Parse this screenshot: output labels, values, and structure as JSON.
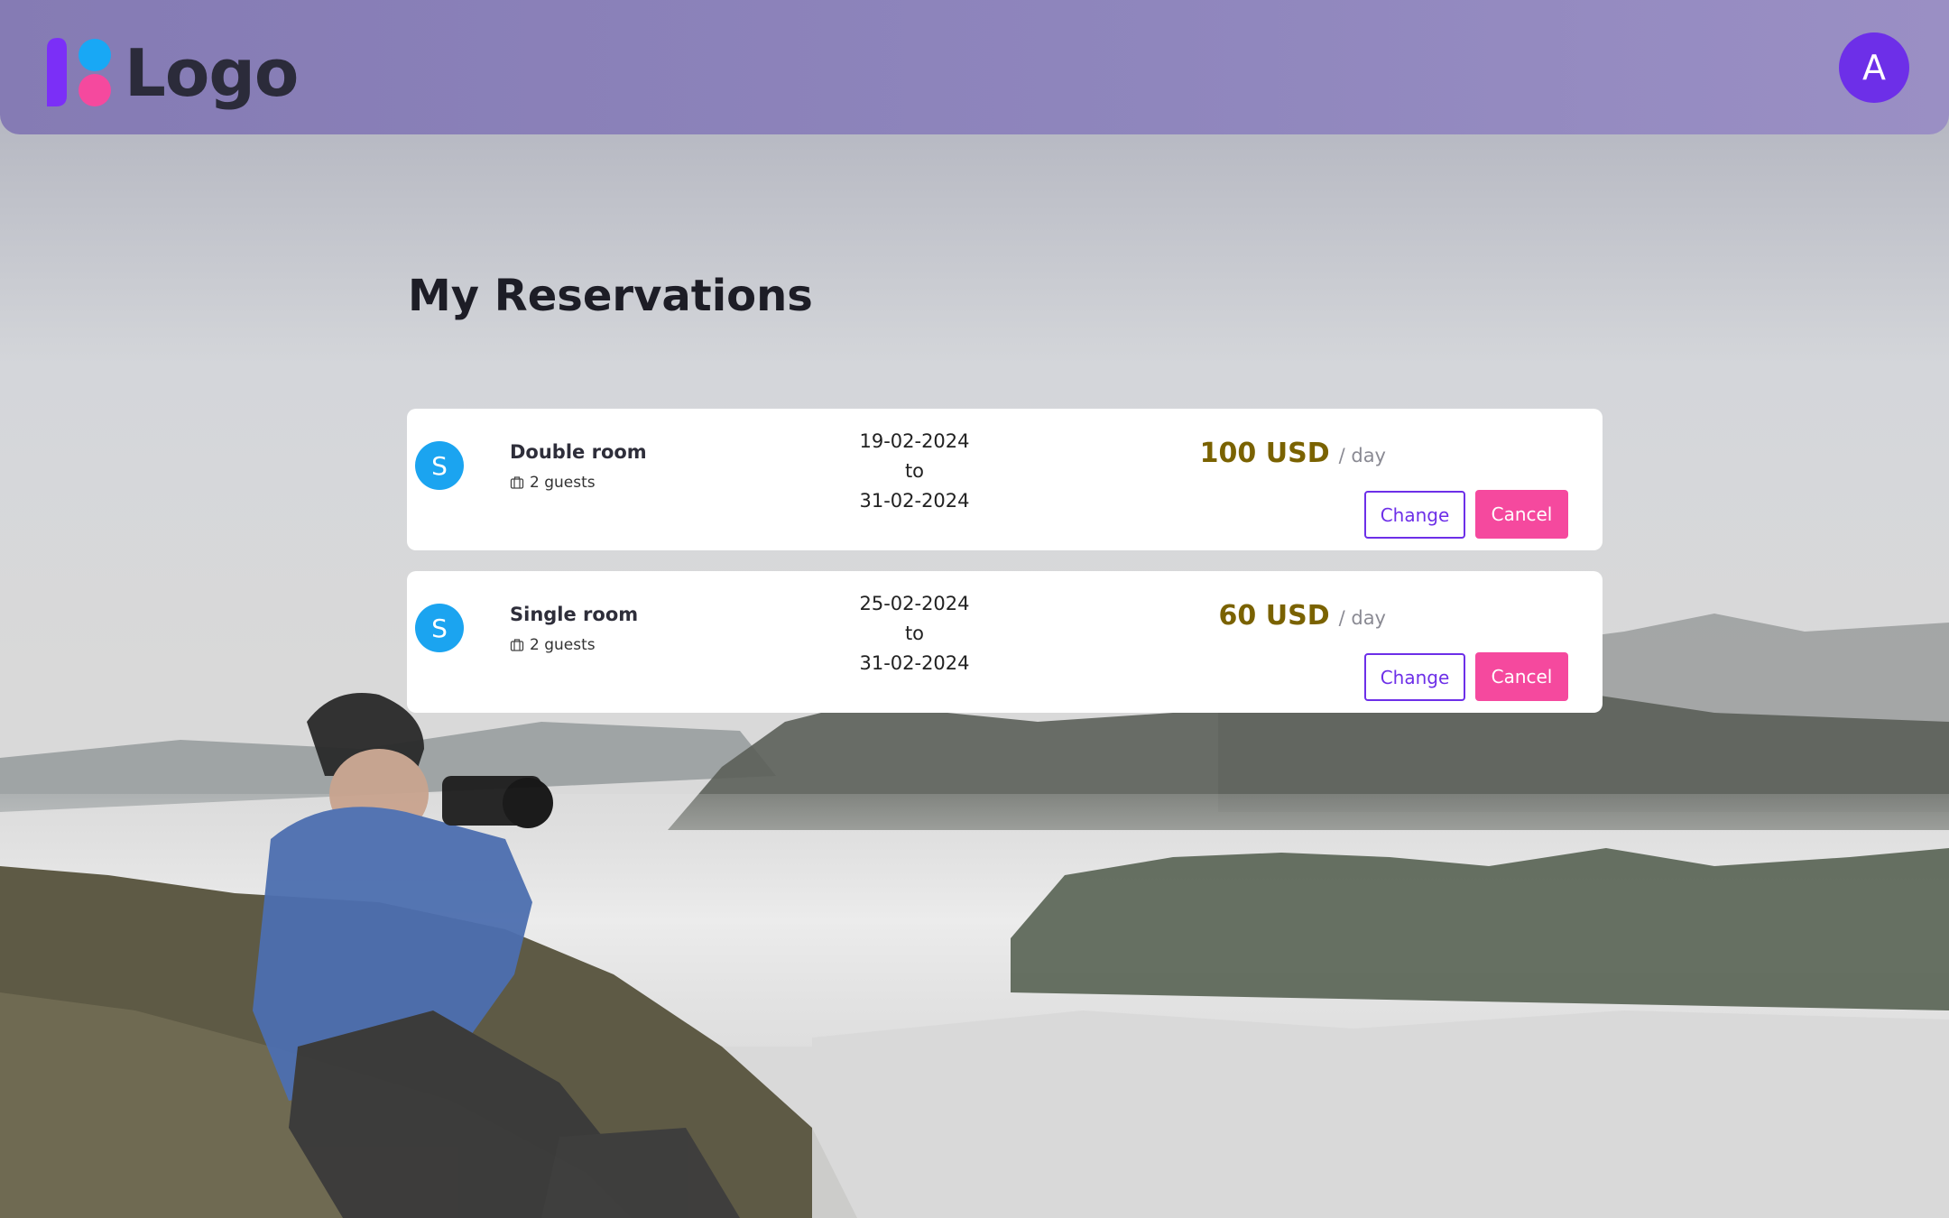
{
  "header": {
    "logo_text": "Logo",
    "avatar_initial": "A"
  },
  "main": {
    "title": "My Reservations",
    "reservations": [
      {
        "badge": "S",
        "room": "Double room",
        "guests": "2 guests",
        "date_from": "19-02-2024",
        "to_word": "to",
        "date_to": "31-02-2024",
        "price": "100 USD",
        "unit": "/ day",
        "change_label": "Change",
        "cancel_label": "Cancel"
      },
      {
        "badge": "S",
        "room": "Single room",
        "guests": "2 guests",
        "date_from": "25-02-2024",
        "to_word": "to",
        "date_to": "31-02-2024",
        "price": "60 USD",
        "unit": "/ day",
        "change_label": "Change",
        "cancel_label": "Cancel"
      }
    ]
  },
  "colors": {
    "header_bg": "#8f86bd",
    "avatar_bg": "#6d2fe8",
    "badge_bg": "#1ba4f0",
    "price": "#7a6200",
    "accent": "#6d2fe8",
    "cancel_bg": "#f5499e"
  },
  "icons": {
    "logo": "logo-mark-icon",
    "guests": "luggage-icon"
  }
}
